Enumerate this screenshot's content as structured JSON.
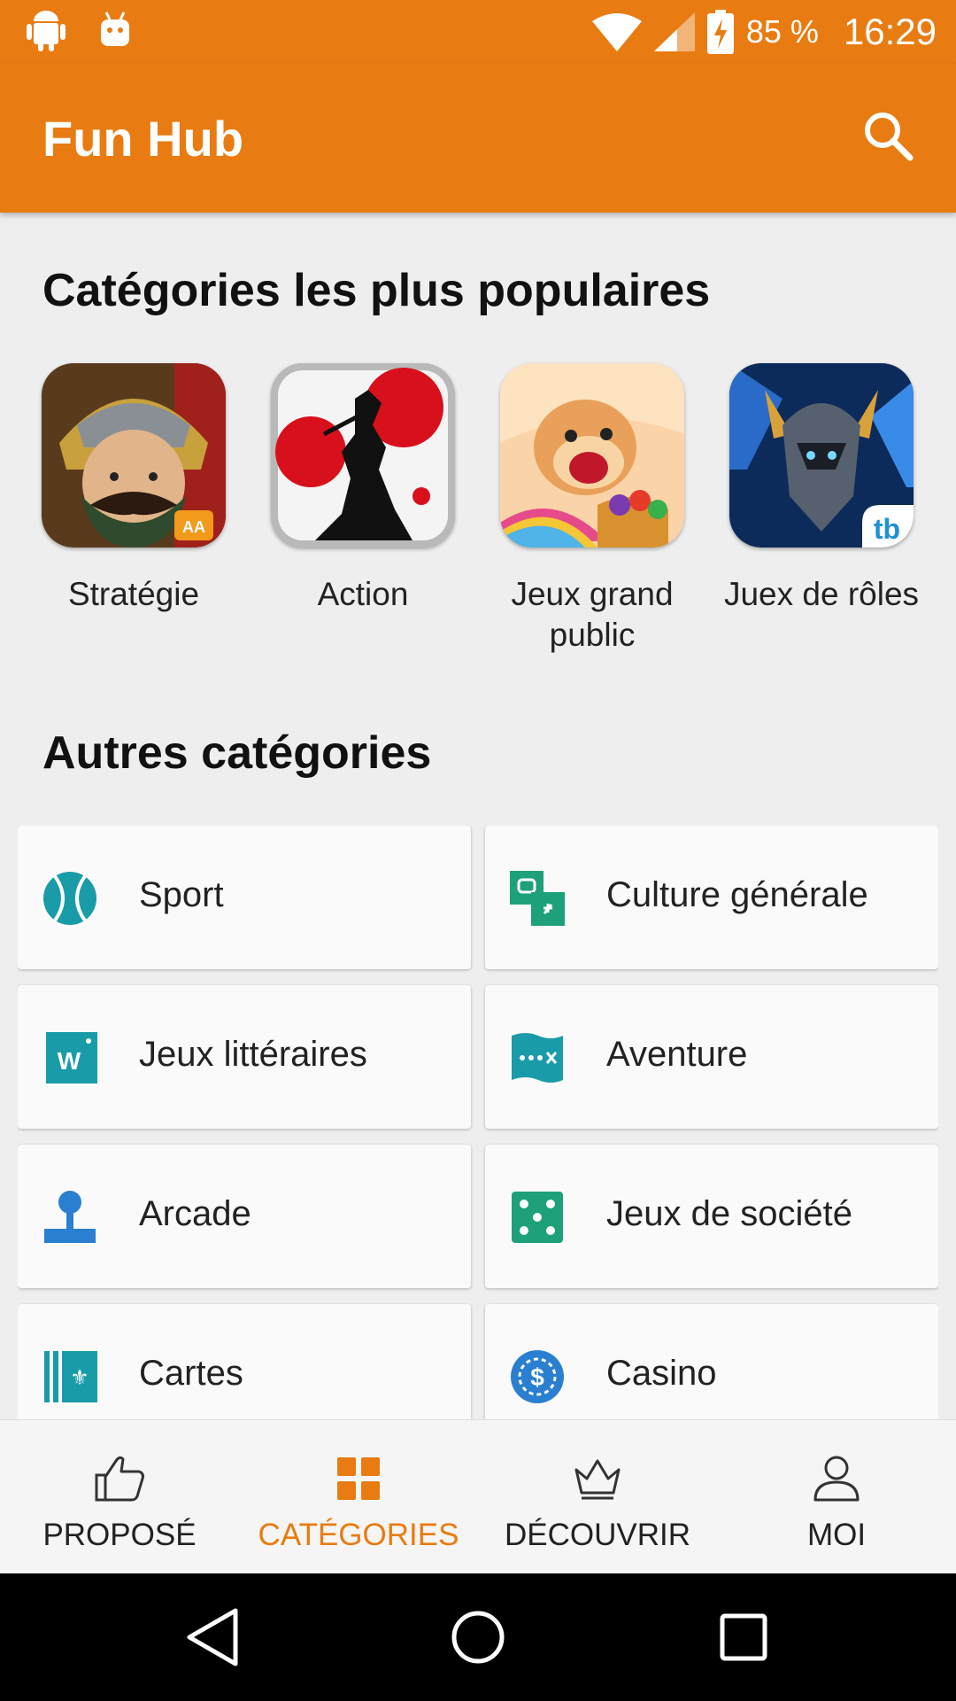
{
  "status_bar": {
    "battery_percent": "85 %",
    "time": "16:29",
    "icons": [
      "android-icon",
      "android-debug-icon",
      "wifi-icon",
      "signal-icon",
      "battery-charging-icon"
    ]
  },
  "app_bar": {
    "title": "Fun Hub",
    "search_icon": "search-icon",
    "background": "#e87c12"
  },
  "popular": {
    "title": "Catégories les plus populaires",
    "items": [
      {
        "label": "Stratégie"
      },
      {
        "label": "Action"
      },
      {
        "label": "Jeux grand public"
      },
      {
        "label": "Juex de rôles"
      }
    ]
  },
  "other": {
    "title": "Autres catégories",
    "items": [
      {
        "label": "Sport",
        "icon": "tennis-ball-icon",
        "color": "#1a9ba8"
      },
      {
        "label": "Culture générale",
        "icon": "quiz-icon",
        "color": "#1ea07a"
      },
      {
        "label": "Jeux littéraires",
        "icon": "word-tile-icon",
        "color": "#1a9ba8"
      },
      {
        "label": "Aventure",
        "icon": "treasure-map-icon",
        "color": "#1a9ba8"
      },
      {
        "label": "Arcade",
        "icon": "joystick-icon",
        "color": "#2a7fd0"
      },
      {
        "label": "Jeux de société",
        "icon": "dice-icon",
        "color": "#1ea07a"
      },
      {
        "label": "Cartes",
        "icon": "playing-card-icon",
        "color": "#1a9ba8"
      },
      {
        "label": "Casino",
        "icon": "casino-chip-icon",
        "color": "#2a7fd0"
      }
    ]
  },
  "bottom_nav": {
    "accent": "#e87c12",
    "items": [
      {
        "label": "PROPOSÉ",
        "icon": "thumbs-up-icon",
        "active": false
      },
      {
        "label": "CATÉGORIES",
        "icon": "grid-icon",
        "active": true
      },
      {
        "label": "DÉCOUVRIR",
        "icon": "crown-icon",
        "active": false
      },
      {
        "label": "MOI",
        "icon": "person-icon",
        "active": false
      }
    ]
  },
  "system_nav": {
    "icons": [
      "back-icon",
      "home-icon",
      "recents-icon"
    ]
  }
}
